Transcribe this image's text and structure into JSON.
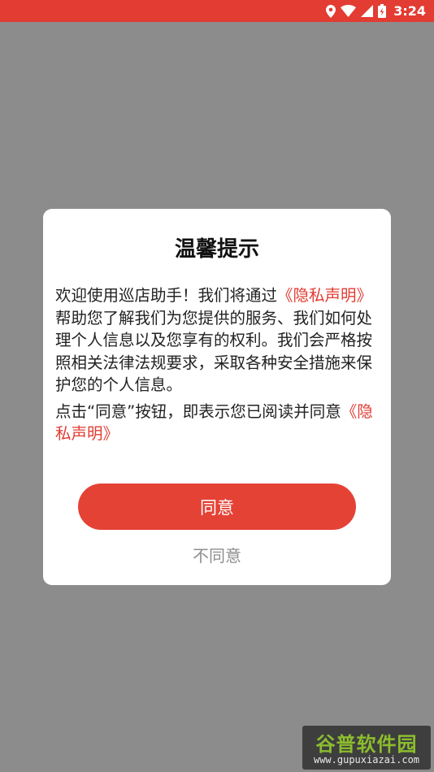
{
  "status_bar": {
    "time": "3:24",
    "icons": [
      "location-icon",
      "wifi-icon",
      "signal-icon",
      "battery-icon"
    ],
    "background_color": "#e23c33"
  },
  "dialog": {
    "title": "温馨提示",
    "para1_before_link": "欢迎使用巡店助手！我们将通过",
    "para1_link": "《隐私声明》",
    "para1_after_link": "帮助您了解我们为您提供的服务、我们如何处理个人信息以及您享有的权利。我们会严格按照相关法律法规要求，采取各种安全措施来保护您的个人信息。",
    "para2_before_link": "点击“同意”按钮，即表示您已阅读并同意",
    "para2_link": "《隐私声明》",
    "agree_label": "同意",
    "disagree_label": "不同意",
    "accent_color": "#e54236"
  },
  "watermark": {
    "logo_text": "谷普软件园",
    "url": "www.gupuxiazai.com"
  }
}
